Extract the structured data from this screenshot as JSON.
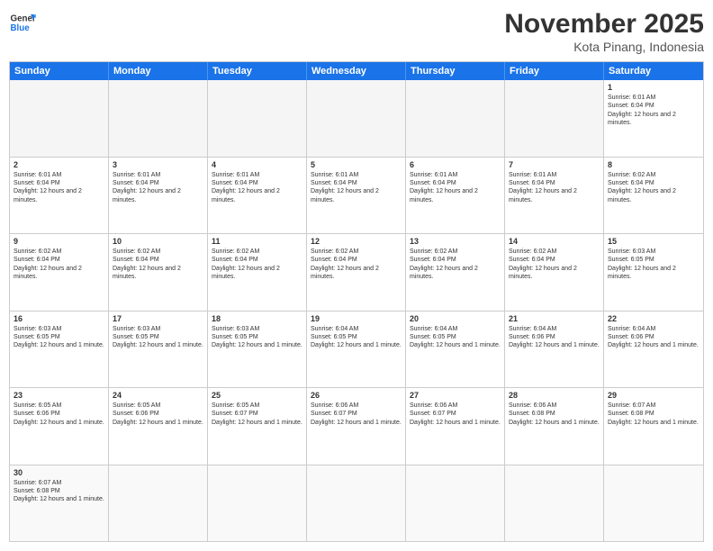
{
  "header": {
    "logo_general": "General",
    "logo_blue": "Blue",
    "month_year": "November 2025",
    "location": "Kota Pinang, Indonesia"
  },
  "days_of_week": [
    "Sunday",
    "Monday",
    "Tuesday",
    "Wednesday",
    "Thursday",
    "Friday",
    "Saturday"
  ],
  "weeks": [
    [
      {
        "day": "",
        "info": ""
      },
      {
        "day": "",
        "info": ""
      },
      {
        "day": "",
        "info": ""
      },
      {
        "day": "",
        "info": ""
      },
      {
        "day": "",
        "info": ""
      },
      {
        "day": "",
        "info": ""
      },
      {
        "day": "1",
        "info": "Sunrise: 6:01 AM\nSunset: 6:04 PM\nDaylight: 12 hours and 2 minutes."
      }
    ],
    [
      {
        "day": "2",
        "info": "Sunrise: 6:01 AM\nSunset: 6:04 PM\nDaylight: 12 hours and 2 minutes."
      },
      {
        "day": "3",
        "info": "Sunrise: 6:01 AM\nSunset: 6:04 PM\nDaylight: 12 hours and 2 minutes."
      },
      {
        "day": "4",
        "info": "Sunrise: 6:01 AM\nSunset: 6:04 PM\nDaylight: 12 hours and 2 minutes."
      },
      {
        "day": "5",
        "info": "Sunrise: 6:01 AM\nSunset: 6:04 PM\nDaylight: 12 hours and 2 minutes."
      },
      {
        "day": "6",
        "info": "Sunrise: 6:01 AM\nSunset: 6:04 PM\nDaylight: 12 hours and 2 minutes."
      },
      {
        "day": "7",
        "info": "Sunrise: 6:01 AM\nSunset: 6:04 PM\nDaylight: 12 hours and 2 minutes."
      },
      {
        "day": "8",
        "info": "Sunrise: 6:02 AM\nSunset: 6:04 PM\nDaylight: 12 hours and 2 minutes."
      }
    ],
    [
      {
        "day": "9",
        "info": "Sunrise: 6:02 AM\nSunset: 6:04 PM\nDaylight: 12 hours and 2 minutes."
      },
      {
        "day": "10",
        "info": "Sunrise: 6:02 AM\nSunset: 6:04 PM\nDaylight: 12 hours and 2 minutes."
      },
      {
        "day": "11",
        "info": "Sunrise: 6:02 AM\nSunset: 6:04 PM\nDaylight: 12 hours and 2 minutes."
      },
      {
        "day": "12",
        "info": "Sunrise: 6:02 AM\nSunset: 6:04 PM\nDaylight: 12 hours and 2 minutes."
      },
      {
        "day": "13",
        "info": "Sunrise: 6:02 AM\nSunset: 6:04 PM\nDaylight: 12 hours and 2 minutes."
      },
      {
        "day": "14",
        "info": "Sunrise: 6:02 AM\nSunset: 6:04 PM\nDaylight: 12 hours and 2 minutes."
      },
      {
        "day": "15",
        "info": "Sunrise: 6:03 AM\nSunset: 6:05 PM\nDaylight: 12 hours and 2 minutes."
      }
    ],
    [
      {
        "day": "16",
        "info": "Sunrise: 6:03 AM\nSunset: 6:05 PM\nDaylight: 12 hours and 1 minute."
      },
      {
        "day": "17",
        "info": "Sunrise: 6:03 AM\nSunset: 6:05 PM\nDaylight: 12 hours and 1 minute."
      },
      {
        "day": "18",
        "info": "Sunrise: 6:03 AM\nSunset: 6:05 PM\nDaylight: 12 hours and 1 minute."
      },
      {
        "day": "19",
        "info": "Sunrise: 6:04 AM\nSunset: 6:05 PM\nDaylight: 12 hours and 1 minute."
      },
      {
        "day": "20",
        "info": "Sunrise: 6:04 AM\nSunset: 6:05 PM\nDaylight: 12 hours and 1 minute."
      },
      {
        "day": "21",
        "info": "Sunrise: 6:04 AM\nSunset: 6:06 PM\nDaylight: 12 hours and 1 minute."
      },
      {
        "day": "22",
        "info": "Sunrise: 6:04 AM\nSunset: 6:06 PM\nDaylight: 12 hours and 1 minute."
      }
    ],
    [
      {
        "day": "23",
        "info": "Sunrise: 6:05 AM\nSunset: 6:06 PM\nDaylight: 12 hours and 1 minute."
      },
      {
        "day": "24",
        "info": "Sunrise: 6:05 AM\nSunset: 6:06 PM\nDaylight: 12 hours and 1 minute."
      },
      {
        "day": "25",
        "info": "Sunrise: 6:05 AM\nSunset: 6:07 PM\nDaylight: 12 hours and 1 minute."
      },
      {
        "day": "26",
        "info": "Sunrise: 6:06 AM\nSunset: 6:07 PM\nDaylight: 12 hours and 1 minute."
      },
      {
        "day": "27",
        "info": "Sunrise: 6:06 AM\nSunset: 6:07 PM\nDaylight: 12 hours and 1 minute."
      },
      {
        "day": "28",
        "info": "Sunrise: 6:06 AM\nSunset: 6:08 PM\nDaylight: 12 hours and 1 minute."
      },
      {
        "day": "29",
        "info": "Sunrise: 6:07 AM\nSunset: 6:08 PM\nDaylight: 12 hours and 1 minute."
      }
    ],
    [
      {
        "day": "30",
        "info": "Sunrise: 6:07 AM\nSunset: 6:08 PM\nDaylight: 12 hours and 1 minute."
      },
      {
        "day": "",
        "info": ""
      },
      {
        "day": "",
        "info": ""
      },
      {
        "day": "",
        "info": ""
      },
      {
        "day": "",
        "info": ""
      },
      {
        "day": "",
        "info": ""
      },
      {
        "day": "",
        "info": ""
      }
    ]
  ]
}
